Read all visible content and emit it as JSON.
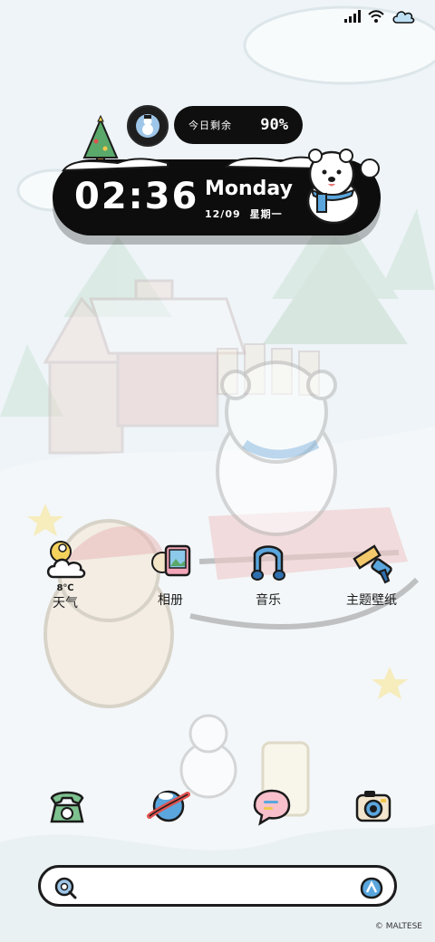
{
  "status": {
    "signal_icon": "signal-icon",
    "wifi_icon": "wifi-icon",
    "cloud_icon": "cloud-icon"
  },
  "widget": {
    "battery_label": "今日剩余",
    "battery_value": "90%",
    "time": "02:36",
    "weekday": "Monday",
    "date": "12/09",
    "weekday_cn": "星期一"
  },
  "apps": [
    {
      "label": "天气",
      "icon": "weather-icon",
      "temp": "8℃"
    },
    {
      "label": "相册",
      "icon": "gallery-icon"
    },
    {
      "label": "音乐",
      "icon": "music-icon"
    },
    {
      "label": "主题壁纸",
      "icon": "theme-wallpaper-icon"
    }
  ],
  "dock": [
    {
      "icon": "phone-icon"
    },
    {
      "icon": "browser-icon"
    },
    {
      "icon": "messages-icon"
    },
    {
      "icon": "camera-icon"
    }
  ],
  "search": {
    "search_icon": "search-icon",
    "assistant_icon": "assistant-icon"
  },
  "footer": {
    "copyright": "© MALTESE"
  },
  "colors": {
    "accent": "#2b6fb5",
    "background": "#eef4f7",
    "widget": "#0d0d0d"
  }
}
